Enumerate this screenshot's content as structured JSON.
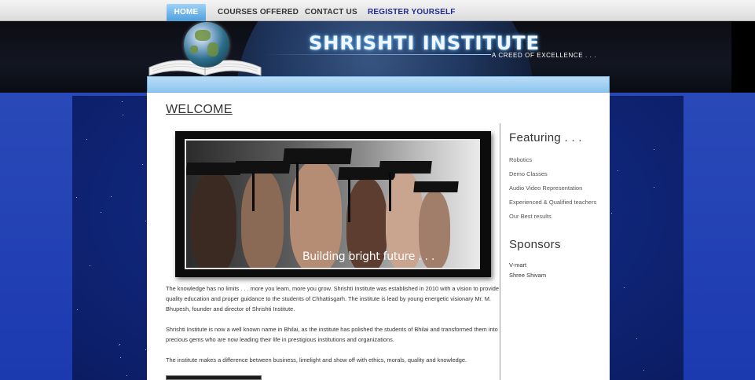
{
  "nav": {
    "home": "HOME",
    "courses": "COURSES OFFERED",
    "contact": "CONTACT US",
    "register": "REGISTER YOURSELF"
  },
  "header": {
    "title": "SHRISHTI INSTITUTE",
    "tagline": "A CREED OF EXCELLENCE . . ."
  },
  "main": {
    "heading": "WELCOME",
    "photo_caption": "Building bright future . . .",
    "paragraphs": [
      "The knowledge has no limits . . . more you learn, more you grow. Shrishti Institute was established in 2010 with a vision to provide quality education and proper guidance to the students of Chhattisgarh. The institute is lead by young energetic visionary Mr. M. Bhupesh, founder and director of Shrishti Institute.",
      "Shrishti Institute is now a well known name in Bhilai, as the institute has polished the students of Bhilai and transformed them into precious gems who are now leading their life in prestigious institutions and organizations.",
      "The institute makes a difference between business, limelight and show off with ethics, morals, quality and knowledge."
    ]
  },
  "sidebar": {
    "featuring_title": "Featuring . . .",
    "featuring_items": [
      "Robotics",
      "Demo Classes",
      "Audio Video Representation",
      "Experienced & Qualified teachers",
      "Our Best results"
    ],
    "sponsors_title": "Sponsors",
    "sponsors": [
      "V-mart",
      "Shree Shivam"
    ]
  },
  "colors": {
    "nav_active": "#4e9fdc",
    "register_link": "#1f2c8e",
    "page_blue": "#1c3ab0",
    "panel_bar": "#8ec6ef"
  }
}
